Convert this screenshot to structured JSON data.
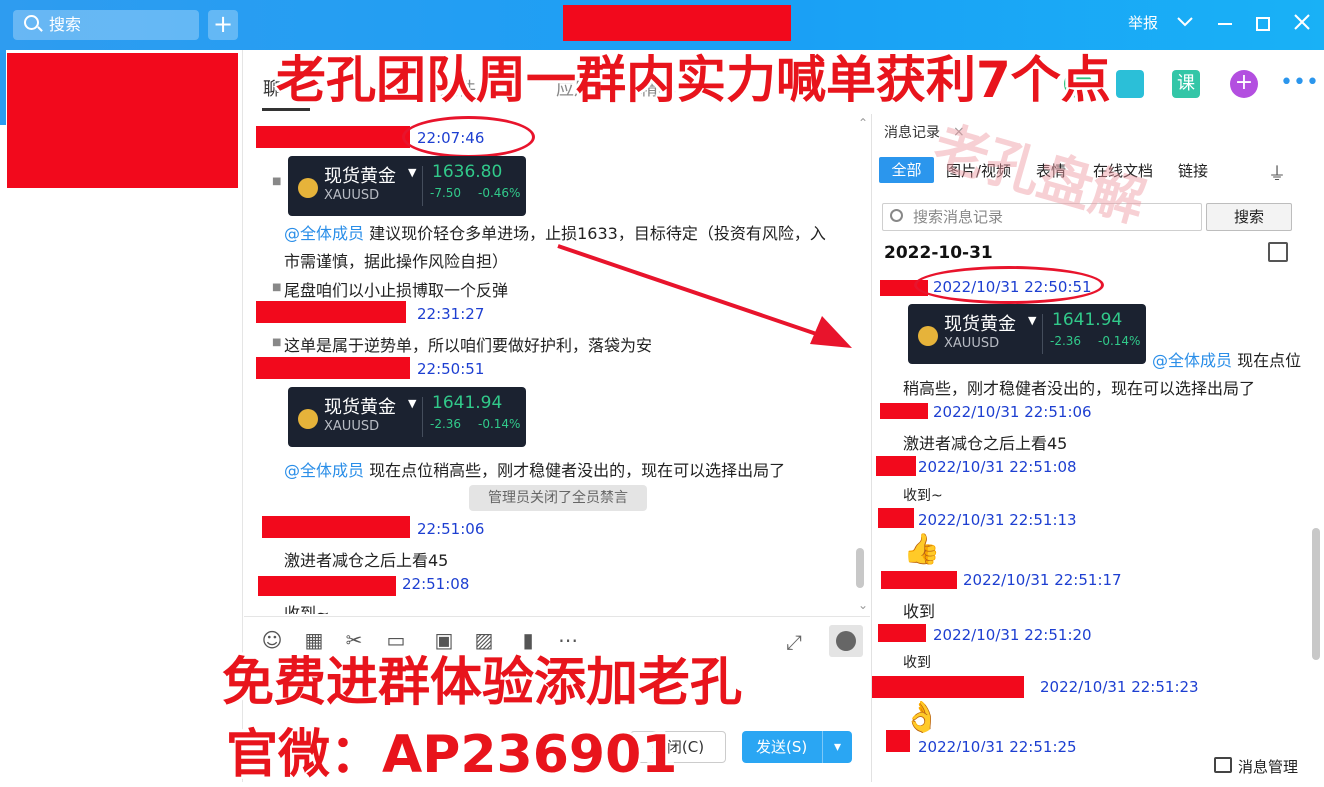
{
  "titlebar": {
    "search_placeholder": "搜索",
    "add_icon": "plus-icon",
    "report_label": "举报",
    "controls": [
      "chevron-down-icon",
      "minimize-icon",
      "maximize-icon",
      "close-icon"
    ]
  },
  "chat_header": {
    "tabs": [
      "聊",
      "文件",
      "应用",
      "精华"
    ]
  },
  "chat": {
    "messages": [
      {
        "time": "22:07:46"
      },
      {
        "card": {
          "name": "现货黄金",
          "code": "XAUUSD",
          "price": "1636.80",
          "change": "-7.50",
          "pct": "-0.46%"
        }
      },
      {
        "at": "@全体成员",
        "text": "建议现价轻仓多单进场，止损1633，目标待定（投资有风险，入",
        "text2": "市需谨慎，据此操作风险自担）"
      },
      {
        "text": "尾盘咱们以小止损博取一个反弹"
      },
      {
        "time": "22:31:27"
      },
      {
        "text": "这单是属于逆势单，所以咱们要做好护利，落袋为安"
      },
      {
        "time": "22:50:51"
      },
      {
        "card": {
          "name": "现货黄金",
          "code": "XAUUSD",
          "price": "1641.94",
          "change": "-2.36",
          "pct": "-0.14%"
        }
      },
      {
        "at": "@全体成员",
        "text": "现在点位稍高些，刚才稳健者没出的，现在可以选择出局了"
      },
      {
        "system": "管理员关闭了全员禁言"
      },
      {
        "time": "22:51:06"
      },
      {
        "text": "激进者减仓之后上看45"
      },
      {
        "time": "22:51:08"
      },
      {
        "text": "收到~"
      }
    ]
  },
  "input": {
    "close_label": "关闭(C)",
    "send_label": "发送(S)",
    "tools": [
      "emoji-icon",
      "gif-icon",
      "scissors-icon",
      "folder-icon",
      "screen-share-icon",
      "image-icon",
      "red-packet-icon",
      "more-icon"
    ]
  },
  "history": {
    "title": "消息记录",
    "tabs": [
      "全部",
      "图片/视频",
      "表情",
      "在线文档",
      "链接"
    ],
    "search_placeholder": "搜索消息记录",
    "search_button": "搜索",
    "date": "2022-10-31",
    "entries": [
      {
        "time": "2022/10/31 22:50:51"
      },
      {
        "card": {
          "name": "现货黄金",
          "code": "XAUUSD",
          "price": "1641.94",
          "change": "-2.36",
          "pct": "-0.14%"
        },
        "at": "@全体成员",
        "text": "现在点位",
        "text2": "稍高些，刚才稳健者没出的，现在可以选择出局了"
      },
      {
        "time": "2022/10/31 22:51:06",
        "text": "激进者减仓之后上看45"
      },
      {
        "time": "2022/10/31 22:51:08",
        "text": "收到~"
      },
      {
        "time": "2022/10/31 22:51:13",
        "emoji": "👍"
      },
      {
        "time": "2022/10/31 22:51:17",
        "text": "收到"
      },
      {
        "time": "2022/10/31 22:51:20",
        "text": "收到"
      },
      {
        "time": "2022/10/31 22:51:23",
        "emoji": "👌"
      },
      {
        "time": "2022/10/31 22:51:25"
      }
    ],
    "footer": "消息管理"
  },
  "overlay": {
    "top_banner": "老孔团队周一群内实力喊单获利7个点",
    "bottom_banner_1": "免费进群体验添加老孔",
    "bottom_banner_2": "官微：AP236901",
    "watermark": "老孔盘解"
  },
  "colors": {
    "accent": "#2b96ed",
    "timestamp": "#1d3fd1",
    "banner": "#e8141c",
    "up": "#31c98a"
  }
}
